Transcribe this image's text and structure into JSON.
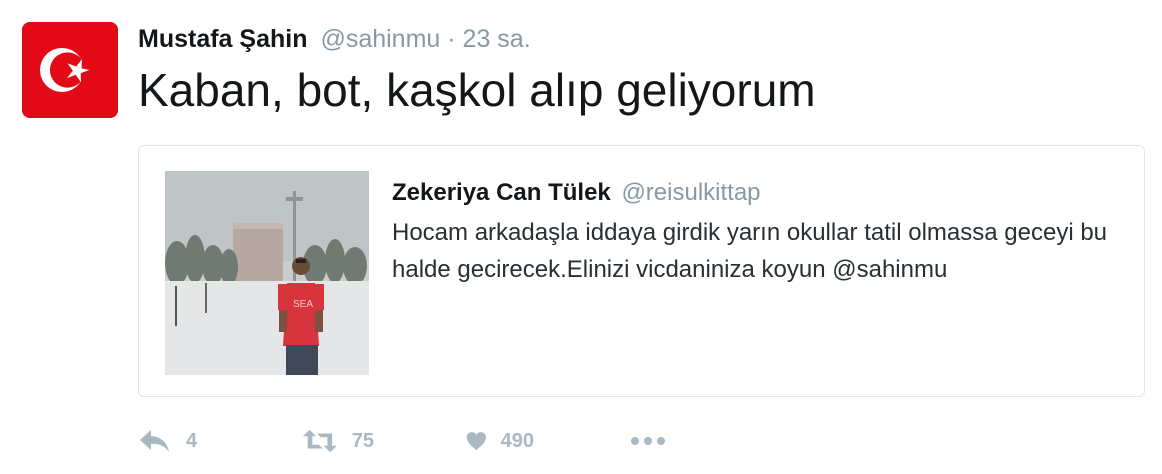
{
  "tweet": {
    "author_name": "Mustafa Şahin",
    "author_handle": "@sahinmu",
    "separator": "·",
    "time": "23 sa.",
    "text": "Kaban, bot, kaşkol alıp geliyorum"
  },
  "quoted_tweet": {
    "author_name": "Zekeriya Can Tülek",
    "author_handle": "@reisulkittap",
    "text": "Hocam arkadaşla iddaya girdik yarın okullar tatil olmassa geceyi bu halde gecirecek.Elinizi vicdaniniza koyun @sahinmu",
    "shirt_text": "SEA"
  },
  "actions": {
    "reply_icon": "reply-icon",
    "reply_count": "4",
    "retweet_icon": "retweet-icon",
    "retweet_count": "75",
    "like_icon": "heart-icon",
    "like_count": "490",
    "more_icon": "more-icon"
  },
  "colors": {
    "avatar_red": "#e30a17",
    "secondary_text": "#8899a6",
    "action_gray": "#aab8c2",
    "border": "#e1e8ed"
  }
}
